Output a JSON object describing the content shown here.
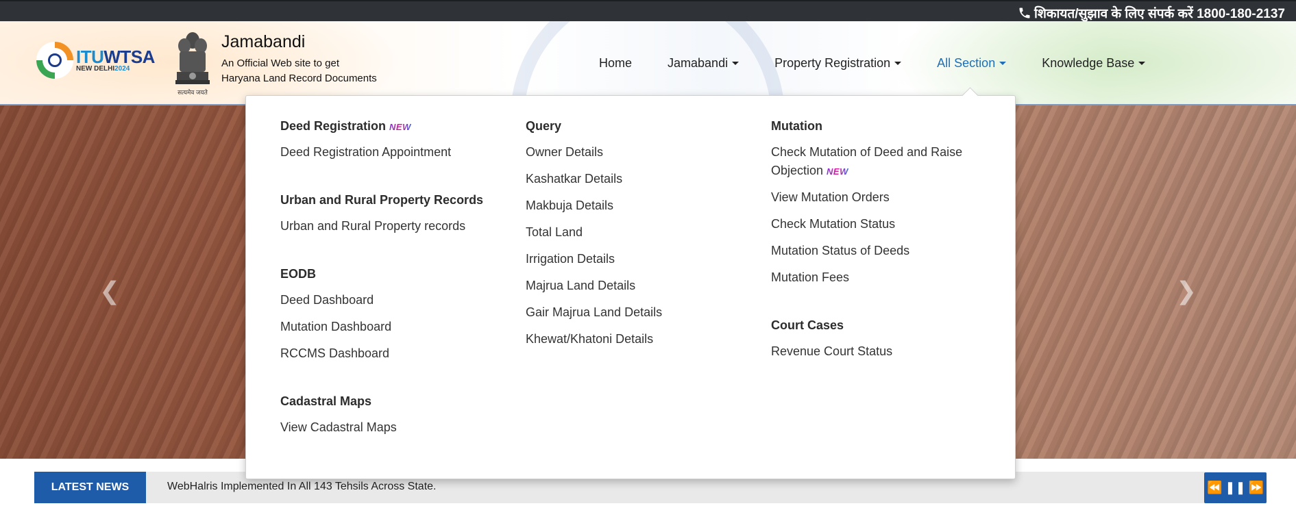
{
  "topbar": {
    "contact_text": "शिकायत/सुझाव के लिए संपर्क करें 1800-180-2137"
  },
  "header": {
    "itu_logo": {
      "part1": "ITU",
      "part2": "WTSA",
      "city": "NEW DELHI",
      "year": "2024"
    },
    "emblem_motto": "सत्यमेव जयते",
    "site_name": "Jamabandi",
    "subtitle_line1": "An Official Web site to get",
    "subtitle_line2": "Haryana Land Record Documents"
  },
  "nav": {
    "items": [
      {
        "label": "Home",
        "has_caret": false,
        "active": false
      },
      {
        "label": "Jamabandi",
        "has_caret": true,
        "active": false
      },
      {
        "label": "Property Registration",
        "has_caret": true,
        "active": false
      },
      {
        "label": "All Section",
        "has_caret": true,
        "active": true
      },
      {
        "label": "Knowledge Base",
        "has_caret": true,
        "active": false
      }
    ]
  },
  "dropdown": {
    "new_badge": "NEW",
    "col1": {
      "deed_head": "Deed Registration",
      "deed_appointment": "Deed Registration Appointment",
      "urban_head": "Urban and Rural Property Records",
      "urban_link": "Urban and Rural Property records",
      "eodb_head": "EODB",
      "deed_dashboard": "Deed Dashboard",
      "mutation_dashboard": "Mutation Dashboard",
      "rccms_dashboard": "RCCMS Dashboard",
      "cadastral_head": "Cadastral Maps",
      "cadastral_link": "View Cadastral Maps"
    },
    "col2": {
      "query_head": "Query",
      "owner": "Owner Details",
      "kashatkar": "Kashatkar Details",
      "makbuja": "Makbuja Details",
      "total_land": "Total Land",
      "irrigation": "Irrigation Details",
      "majrua": "Majrua Land Details",
      "gair_majrua": "Gair Majrua Land Details",
      "khewat": "Khewat/Khatoni Details"
    },
    "col3": {
      "mutation_head": "Mutation",
      "check_mutation_deed": "Check Mutation of Deed and Raise Objection",
      "view_orders": "View Mutation Orders",
      "check_status": "Check Mutation Status",
      "status_deeds": "Mutation Status of Deeds",
      "fees": "Mutation Fees",
      "court_head": "Court Cases",
      "revenue_court": "Revenue Court Status"
    }
  },
  "news": {
    "label": "LATEST NEWS",
    "ticker": "WebHalris Implemented In All 143 Tehsils Across State."
  },
  "colors": {
    "accent_blue": "#1e5ba8",
    "active_nav": "#1e6fb8",
    "topbar_bg": "#2f3338"
  }
}
